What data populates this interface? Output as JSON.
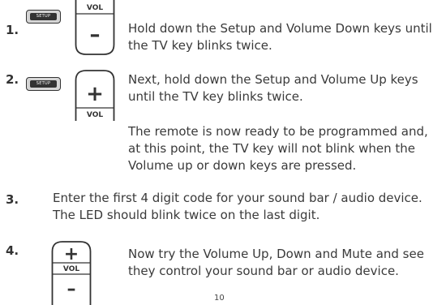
{
  "labels": {
    "setup": "SETUP",
    "vol": "VOL",
    "plus": "+",
    "minus": "–"
  },
  "steps": [
    {
      "number": "1.",
      "text": [
        "Hold down the Setup and Volume Down keys until",
        "the TV key blinks twice."
      ]
    },
    {
      "number": "2.",
      "text": [
        "Next, hold down the Setup and Volume Up keys",
        "until the TV key blinks twice."
      ],
      "note": [
        "The remote is now ready to be programmed and,",
        "at this point, the TV key will not blink when the",
        "Volume up or down keys are pressed."
      ]
    },
    {
      "number": "3.",
      "text": [
        "Enter the first 4 digit code for your sound bar / audio device.",
        "The LED should blink twice on the last digit."
      ]
    },
    {
      "number": "4.",
      "text": [
        "Now try the Volume Up, Down and Mute and see",
        "they control your sound bar or audio device."
      ]
    }
  ],
  "page_number": "10"
}
